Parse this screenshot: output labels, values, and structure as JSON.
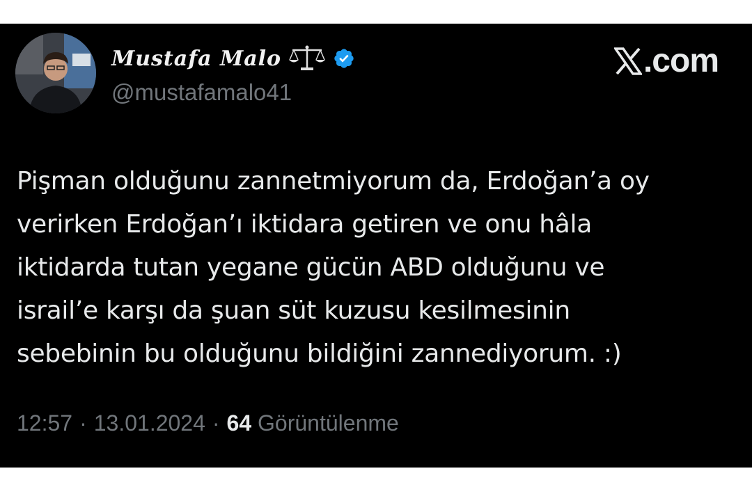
{
  "author": {
    "display_name": "Mustafa Malo",
    "handle": "@mustafamalo41",
    "verified": true,
    "name_icon": "scales-icon",
    "verified_color": "#1d9bf0"
  },
  "brand": {
    "logo_text": ".com",
    "logo_icon": "x-logo-icon"
  },
  "tweet": {
    "text": "Pişman olduğunu zannetmiyorum da, Erdoğan’a oy\nverirken Erdoğan’ı iktidara getiren ve onu hâla\niktidarda tutan yegane gücün ABD olduğunu ve\nisrail’e karşı da şuan süt kuzusu kesilmesinin\nsebebinin bu olduğunu bildiğini zannediyorum. :)"
  },
  "meta": {
    "time": "12:57",
    "separator": "·",
    "date": "13.01.2024",
    "views_count": "64",
    "views_label": "Görüntülenme"
  },
  "colors": {
    "background": "#000000",
    "text": "#e7e9ea",
    "muted": "#71767b"
  }
}
